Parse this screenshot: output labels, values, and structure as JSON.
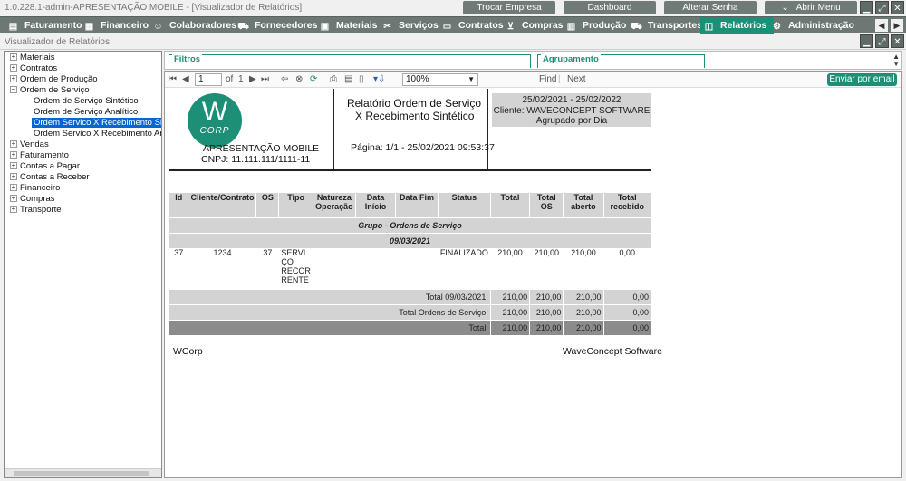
{
  "window_title": "1.0.228.1-admin-APRESENTAÇÃO MOBILE - [Visualizador de Relatórios]",
  "top_buttons": {
    "trocar_empresa": "Trocar Empresa",
    "dashboard": "Dashboard",
    "alterar_senha": "Alterar Senha",
    "abrir_menu": "Abrir Menu"
  },
  "menu": {
    "faturamento": "Faturamento",
    "financeiro": "Financeiro",
    "colaboradores": "Colaboradores",
    "fornecedores": "Fornecedores",
    "materiais": "Materiais",
    "servicos": "Serviços",
    "contratos": "Contratos",
    "compras": "Compras",
    "producao": "Produção",
    "transportes": "Transportes",
    "relatorios": "Relatórios",
    "administracao": "Administração"
  },
  "child_window_title": "Visualizador de Relatórios",
  "tree": {
    "materiais": "Materiais",
    "contratos": "Contratos",
    "ordem_producao": "Ordem de Produção",
    "ordem_servico": "Ordem de Serviço",
    "os_sintetico": "Ordem de Serviço Sintético",
    "os_analitico": "Ordem de Serviço Analítico",
    "os_receb_sintetico": "Ordem Servico X Recebimento Sintético",
    "os_receb_analitico": "Ordem Servico X Recebimento Analítico",
    "vendas": "Vendas",
    "faturamento": "Faturamento",
    "contas_pagar": "Contas a Pagar",
    "contas_receber": "Contas a Receber",
    "financeiro": "Financeiro",
    "compras": "Compras",
    "transporte": "Transporte"
  },
  "filters": {
    "filtros": "Filtros",
    "agrupamento": "Agrupamento"
  },
  "viewer_toolbar": {
    "page_value": "1",
    "of_label": "of",
    "page_total": "1",
    "zoom": "100%",
    "find": "Find",
    "next": "Next",
    "email_button": "Enviar por email"
  },
  "report": {
    "logo_letter": "W",
    "logo_sub": "CORP",
    "company_name": "APRESENTAÇÃO MOBILE",
    "company_cnpj": "CNPJ: 11.111.111/1111-11",
    "title_line1": "Relatório Ordem de Serviço",
    "title_line2": "X Recebimento Sintético",
    "page_info": "Página: 1/1 - 25/02/2021 09:53:37",
    "period": "25/02/2021 - 25/02/2022",
    "client": "Cliente: WAVECONCEPT SOFTWARE",
    "grouping": "Agrupado por Dia",
    "headers": {
      "id": "Id",
      "cliente": "Cliente/Contrato",
      "os": "OS",
      "tipo": "Tipo",
      "natureza1": "Natureza",
      "natureza2": "Operação",
      "data_inicio": "Data Início",
      "data_fim": "Data Fim",
      "status": "Status",
      "total": "Total",
      "total_os": "Total OS",
      "total_aberto1": "Total",
      "total_aberto2": "aberto",
      "total_recebido1": "Total",
      "total_recebido2": "recebido"
    },
    "group_title": "Grupo - Ordens de Serviço",
    "group_date": "09/03/2021",
    "row": {
      "id": "37",
      "cliente": "1234",
      "os": "37",
      "tipo_l1": "SERVI",
      "tipo_l2": "ÇO",
      "tipo_l3": "RECOR",
      "tipo_l4": "RENTE",
      "natureza": "",
      "data_inicio": "",
      "data_fim": "",
      "status": "FINALIZADO",
      "total": "210,00",
      "total_os": "210,00",
      "total_aberto": "210,00",
      "total_recebido": "0,00"
    },
    "sum_date": {
      "label": "Total 09/03/2021:",
      "total": "210,00",
      "total_os": "210,00",
      "aberto": "210,00",
      "recebido": "0,00"
    },
    "sum_group": {
      "label": "Total Ordens de Serviço:",
      "total": "210,00",
      "total_os": "210,00",
      "aberto": "210,00",
      "recebido": "0,00"
    },
    "sum_all": {
      "label": "Total:",
      "total": "210,00",
      "total_os": "210,00",
      "aberto": "210,00",
      "recebido": "0,00"
    },
    "footer_left": "WCorp",
    "footer_right": "WaveConcept Software"
  }
}
